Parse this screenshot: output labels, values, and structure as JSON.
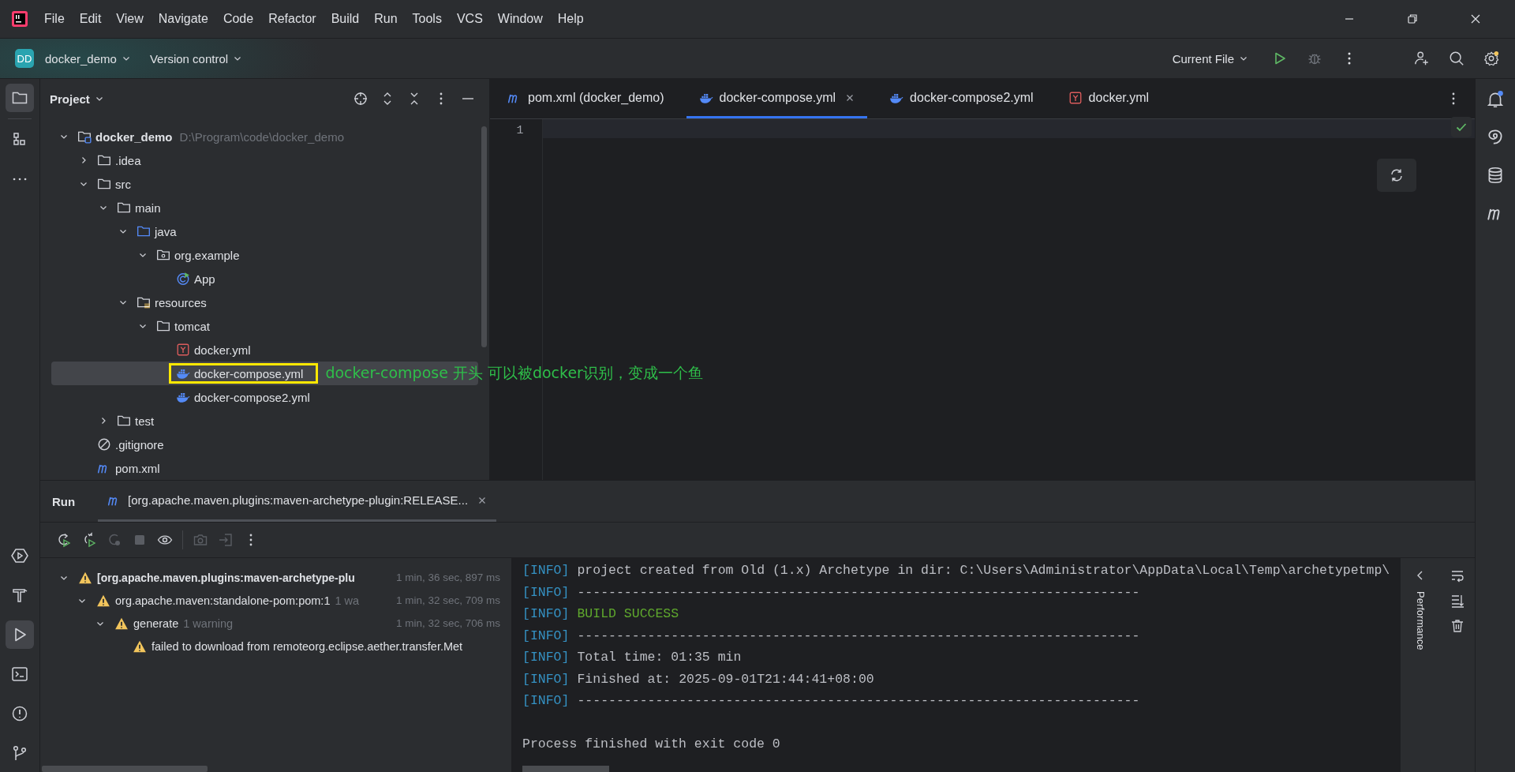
{
  "menu": [
    "File",
    "Edit",
    "View",
    "Navigate",
    "Code",
    "Refactor",
    "Build",
    "Run",
    "Tools",
    "VCS",
    "Window",
    "Help"
  ],
  "toolbar": {
    "project_badge": "DD",
    "project": "docker_demo",
    "vcs": "Version control",
    "run_config": "Current File"
  },
  "left_stripe": [
    {
      "kind": "project",
      "selected": true
    },
    {
      "kind": "structure",
      "selected": false
    },
    {
      "kind": "more",
      "selected": false
    },
    {
      "kind": "services",
      "selected": false
    },
    {
      "kind": "build",
      "selected": false
    },
    {
      "kind": "run",
      "selected": true
    },
    {
      "kind": "terminal",
      "selected": false
    },
    {
      "kind": "problems",
      "selected": false
    },
    {
      "kind": "git",
      "selected": false
    }
  ],
  "project_panel": {
    "title": "Project",
    "tree": [
      {
        "name": "docker_demo",
        "path": "D:\\Program\\code\\docker_demo",
        "kind": "module",
        "expanded": true,
        "selected": false,
        "children": [
          {
            "name": ".idea",
            "kind": "folder",
            "expanded": false,
            "selected": false
          },
          {
            "name": "src",
            "kind": "folder",
            "expanded": true,
            "selected": false,
            "children": [
              {
                "name": "main",
                "kind": "folder",
                "expanded": true,
                "selected": false,
                "children": [
                  {
                    "name": "java",
                    "kind": "source",
                    "expanded": true,
                    "selected": false,
                    "children": [
                      {
                        "name": "org.example",
                        "kind": "package",
                        "expanded": true,
                        "selected": false,
                        "children": [
                          {
                            "name": "App",
                            "kind": "class",
                            "selected": false
                          }
                        ]
                      }
                    ]
                  },
                  {
                    "name": "resources",
                    "kind": "resources",
                    "expanded": true,
                    "selected": false,
                    "children": [
                      {
                        "name": "tomcat",
                        "kind": "folder",
                        "expanded": true,
                        "selected": false,
                        "children": [
                          {
                            "name": "docker.yml",
                            "kind": "yaml",
                            "selected": false
                          },
                          {
                            "name": "docker-compose.yml",
                            "kind": "docker",
                            "selected": true,
                            "note": "docker-compose 开头  可以被docker识别，变成一个鱼"
                          },
                          {
                            "name": "docker-compose2.yml",
                            "kind": "docker",
                            "selected": false
                          }
                        ]
                      }
                    ]
                  }
                ]
              },
              {
                "name": "test",
                "kind": "folder",
                "expanded": false,
                "selected": false
              }
            ]
          },
          {
            "name": ".gitignore",
            "kind": "ignore",
            "selected": false
          },
          {
            "name": "pom.xml",
            "kind": "maven",
            "selected": false
          }
        ]
      }
    ]
  },
  "editor": {
    "tabs": [
      {
        "label": "pom.xml (docker_demo)",
        "kind": "maven",
        "selected": false
      },
      {
        "label": "docker-compose.yml",
        "kind": "docker",
        "selected": true
      },
      {
        "label": "docker-compose2.yml",
        "kind": "docker",
        "selected": false
      },
      {
        "label": "docker.yml",
        "kind": "yaml",
        "selected": false
      }
    ],
    "line_numbers": [
      "1"
    ]
  },
  "run": {
    "title": "Run",
    "tab": "[org.apache.maven.plugins:maven-archetype-plugin:RELEASE...",
    "tree": [
      {
        "label": "[org.apache.maven.plugins:maven-archetype-plu",
        "time": "1 min, 36 sec, 897 ms",
        "expanded": true,
        "bold": true,
        "children": [
          {
            "label": "org.apache.maven:standalone-pom:pom:1",
            "note": "1 wa",
            "time": "1 min, 32 sec, 709 ms",
            "expanded": true,
            "bold": false,
            "children": [
              {
                "label": "generate",
                "note": "1 warning",
                "time": "1 min, 32 sec, 706 ms",
                "expanded": true,
                "bold": false,
                "children": [
                  {
                    "label": "failed to download from remoteorg.eclipse.aether.transfer.Met",
                    "bold": false
                  }
                ]
              }
            ]
          }
        ]
      }
    ],
    "console": [
      {
        "kind": "info",
        "tag": "[INFO]",
        "text": "project created from Old (1.x) Archetype in dir: C:\\Users\\Administrator\\AppData\\Local\\Temp\\archetypetmp\\"
      },
      {
        "kind": "info",
        "tag": "[INFO]",
        "text": "------------------------------------------------------------------------"
      },
      {
        "kind": "success",
        "tag": "[INFO]",
        "text": "BUILD SUCCESS"
      },
      {
        "kind": "info",
        "tag": "[INFO]",
        "text": "------------------------------------------------------------------------"
      },
      {
        "kind": "info",
        "tag": "[INFO]",
        "text": "Total time:  01:35 min"
      },
      {
        "kind": "info",
        "tag": "[INFO]",
        "text": "Finished at: 2025-09-01T21:44:41+08:00"
      },
      {
        "kind": "info",
        "tag": "[INFO]",
        "text": "------------------------------------------------------------------------"
      },
      {
        "kind": "plain",
        "text": "Process finished with exit code 0"
      }
    ],
    "side_label": "Performance"
  }
}
